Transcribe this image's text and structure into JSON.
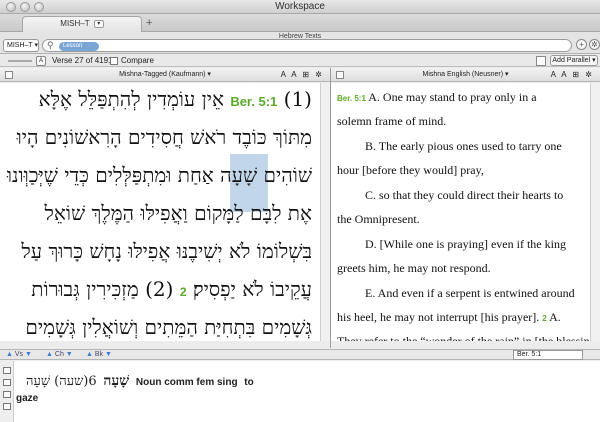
{
  "window": {
    "title": "Workspace"
  },
  "tabs": [
    {
      "label": "MISH–T",
      "subtitle": "Hebrew Texts"
    }
  ],
  "toolbar": {
    "resource_select": "MISH–T ▾",
    "search_pill": "Lesson",
    "add_tab": "+"
  },
  "location": {
    "verse_label": "Verse 27 of 4191",
    "compare_label": "Compare",
    "add_parallel_label": "Add Parallel ▾"
  },
  "left_pane": {
    "title": "Mishna-Tagged (Kaufmann) ▾",
    "tools": "A A ⊞ ✲",
    "verse_ref": "Ber. 5:1",
    "lines": [
      "(1) אֵין עוֹמְדִין לְהִתְפַּלֵּל אֶלָּא",
      "מִתּוֹךְ כּוֹבֶד רֹאשׁ חֲסִידִים הָרִאשׁוֹנִים הָיוּ",
      "שׁוֹהִים שָׁעָה אַחַת וּמִתְפַּלְּלִים כְּדֵי שֶׁיְּכַוְּונוּ",
      "אֶת לִבָּם לַמָּקוֹם וַאֲפִילּוּ הַמֶּלֶךְ שׁוֹאֵל",
      "בִּשְׁלוֹמוֹ לֹא יְשִׁיבֶנּוּ אֲפִילּוּ נָחָשׁ כָּרוּךְ עַל",
      "עֲקֵיבוֹ לֹא יַפְסִיק׃",
      "(2) מַזְכִּירִין גְּבוּרוֹת",
      "גְּשָׁמִים בִּתְחִיַּת הַמֵּתִים וְשׁוֹאֲלִין גְּשָׁמִים"
    ],
    "verse_num_2": "2"
  },
  "right_pane": {
    "title": "Mishna English (Neusner) ▾",
    "tools": "A A ⊞ ✲",
    "verse_ref": "Ber. 5:1",
    "lines": [
      "A.   One may stand to pray only in a",
      "solemn frame of mind.",
      "B.   The early pious ones used to tarry one",
      "hour [before they would] pray,",
      "C.   so that they could direct their hearts to",
      "the Omnipresent.",
      "D.   [While one is praying] even if the king",
      "greets him, he may not respond.",
      "E.   And even if a serpent is entwined around",
      "his heel, he may not interrupt [his prayer].",
      "A.",
      "They refer to the “wonder of the rain” in [the blessing"
    ],
    "verse_num_2": "2"
  },
  "navbar": {
    "items": [
      "Vs",
      "Ch",
      "Bk"
    ],
    "reference": "Ber. 5:1"
  },
  "info": {
    "headword": "שָׁעָה",
    "entry": "(שעה) שָׁעָה",
    "number": "6",
    "grammar": "Noun comm fem sing",
    "gloss_to": "to",
    "gloss": "gaze"
  }
}
